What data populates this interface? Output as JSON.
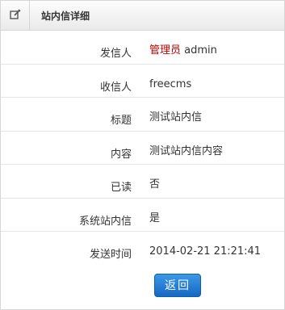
{
  "header": {
    "title": "站内信详细",
    "icon": "edit-icon"
  },
  "fields": {
    "sender": {
      "label": "发信人",
      "role": "管理员",
      "name": "admin"
    },
    "recipient": {
      "label": "收信人",
      "value": "freecms"
    },
    "subject": {
      "label": "标题",
      "value": "测试站内信"
    },
    "content": {
      "label": "内容",
      "value": "测试站内信内容"
    },
    "read": {
      "label": "已读",
      "value": "否"
    },
    "system": {
      "label": "系统站内信",
      "value": "是"
    },
    "sent_time": {
      "label": "发送时间",
      "value": "2014-02-21 21:21:41"
    }
  },
  "actions": {
    "back_label": "返回"
  },
  "colors": {
    "sender_role": "#cc0000",
    "button_top": "#3c99e6",
    "button_bottom": "#1567c4"
  }
}
